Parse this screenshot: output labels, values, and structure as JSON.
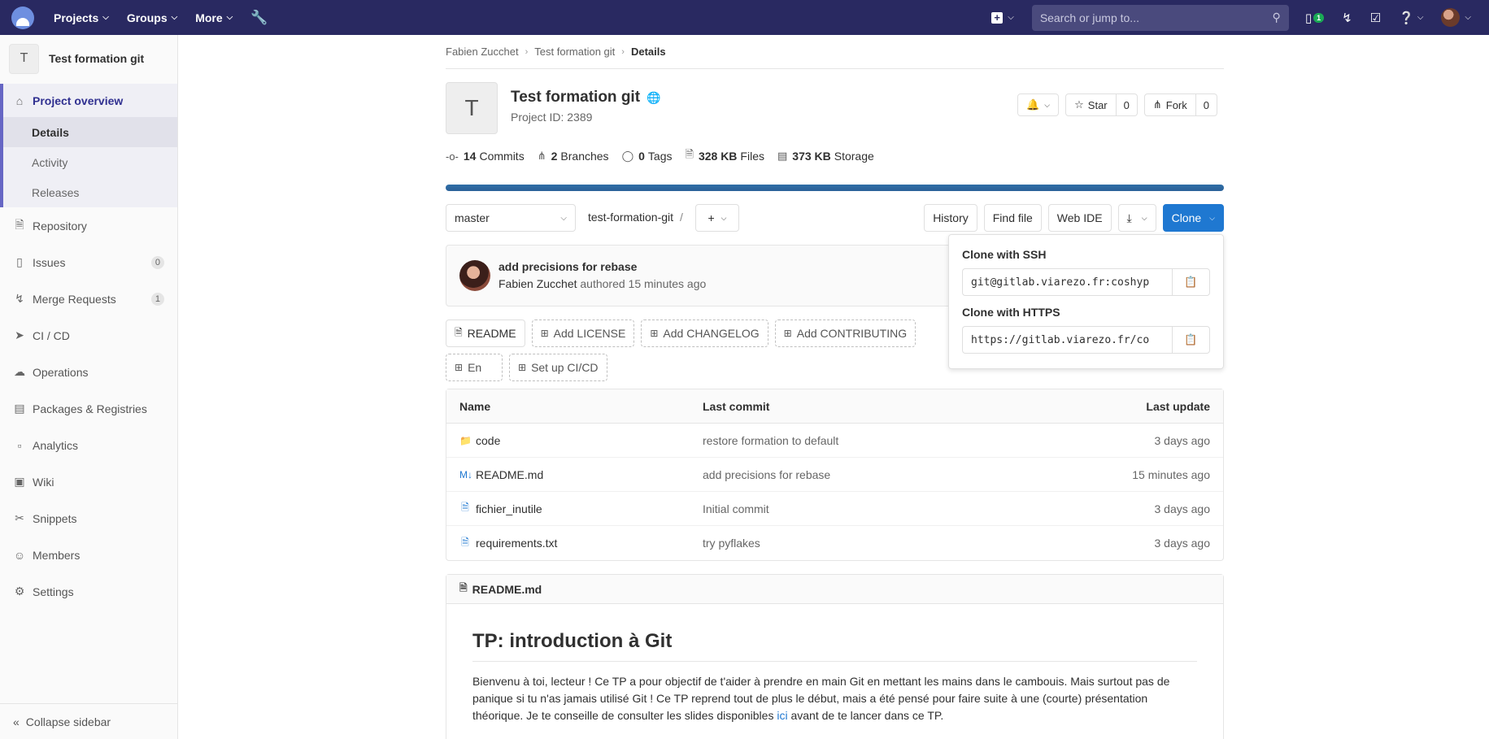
{
  "navbar": {
    "projects": "Projects",
    "groups": "Groups",
    "more": "More",
    "search_placeholder": "Search or jump to...",
    "issues_badge": "1"
  },
  "sidebar": {
    "project_initial": "T",
    "project_name": "Test formation git",
    "overview": "Project overview",
    "sub": [
      "Details",
      "Activity",
      "Releases"
    ],
    "items": [
      {
        "label": "Repository",
        "icon": "doc-icon"
      },
      {
        "label": "Issues",
        "icon": "issues-icon",
        "count": "0"
      },
      {
        "label": "Merge Requests",
        "icon": "merge-request-icon",
        "count": "1"
      },
      {
        "label": "CI / CD",
        "icon": "rocket-icon"
      },
      {
        "label": "Operations",
        "icon": "cloud-icon"
      },
      {
        "label": "Packages & Registries",
        "icon": "package-icon"
      },
      {
        "label": "Analytics",
        "icon": "chart-icon"
      },
      {
        "label": "Wiki",
        "icon": "book-icon"
      },
      {
        "label": "Snippets",
        "icon": "scissors-icon"
      },
      {
        "label": "Members",
        "icon": "users-icon"
      },
      {
        "label": "Settings",
        "icon": "gear-icon"
      }
    ],
    "collapse": "Collapse sidebar"
  },
  "breadcrumb": [
    "Fabien Zucchet",
    "Test formation git",
    "Details"
  ],
  "project": {
    "initial": "T",
    "title": "Test formation git",
    "id_text": "Project ID: 2389",
    "star": "Star",
    "star_count": "0",
    "fork": "Fork",
    "fork_count": "0"
  },
  "stats": [
    {
      "value": "14",
      "label": "Commits"
    },
    {
      "value": "2",
      "label": "Branches"
    },
    {
      "value": "0",
      "label": "Tags"
    },
    {
      "value": "328 KB",
      "label": "Files"
    },
    {
      "value": "373 KB",
      "label": "Storage"
    }
  ],
  "toolbar": {
    "branch": "master",
    "path": "test-formation-git",
    "history": "History",
    "find_file": "Find file",
    "web_ide": "Web IDE",
    "clone": "Clone"
  },
  "commit": {
    "title": "add precisions for rebase",
    "author": "Fabien Zucchet",
    "meta": "authored 15 minutes ago"
  },
  "chips": [
    "README",
    "Add LICENSE",
    "Add CHANGELOG",
    "Add CONTRIBUTING",
    "En",
    "Set up CI/CD"
  ],
  "table": {
    "headers": [
      "Name",
      "Last commit",
      "Last update"
    ],
    "rows": [
      {
        "name": "code",
        "commit": "restore formation to default",
        "updated": "3 days ago"
      },
      {
        "name": "README.md",
        "commit": "add precisions for rebase",
        "updated": "15 minutes ago"
      },
      {
        "name": "fichier_inutile",
        "commit": "Initial commit",
        "updated": "3 days ago"
      },
      {
        "name": "requirements.txt",
        "commit": "try pyflakes",
        "updated": "3 days ago"
      }
    ]
  },
  "readme": {
    "filename": "README.md",
    "heading": "TP: introduction à Git",
    "para_before_link": "Bienvenu à toi, lecteur ! Ce TP a pour objectif de t'aider à prendre en main Git en mettant les mains dans le cambouis. Mais surtout pas de panique si tu n'as jamais utilisé Git ! Ce TP reprend tout de plus le début, mais a été pensé pour faire suite à une (courte) présentation théorique. Je te conseille de consulter les slides disponibles",
    "link": "ici",
    "para_after_link": "avant de te lancer dans ce TP."
  },
  "clone": {
    "ssh_label": "Clone with SSH",
    "ssh_url": "git@gitlab.viarezo.fr:coshyp",
    "https_label": "Clone with HTTPS",
    "https_url": "https://gitlab.viarezo.fr/co"
  }
}
